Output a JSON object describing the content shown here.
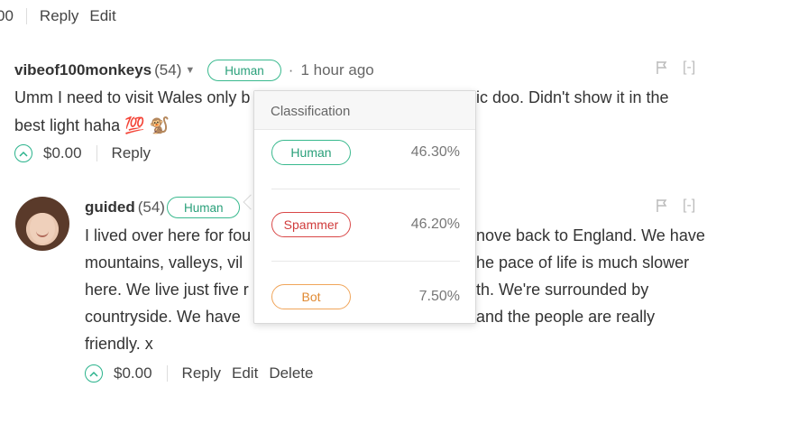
{
  "top_actions": {
    "money_fragment": "00",
    "reply": "Reply",
    "edit": "Edit"
  },
  "comment1": {
    "author": "vibeof100monkeys",
    "reputation": "(54)",
    "badge": "Human",
    "time": "1 hour ago",
    "body_line1_left": "Umm I need to visit Wales only b",
    "body_line1_right": "ic doo. Didn't show it in the",
    "body_line2": "best light haha",
    "emoji": "💯 🐒",
    "payout": "$0.00",
    "reply": "Reply",
    "hide": "[-]"
  },
  "comment2": {
    "author": "guided",
    "reputation": "(54)",
    "badge": "Human",
    "lines": [
      {
        "left": "I lived over here for fou",
        "right": "nove back to England. We have"
      },
      {
        "left": "mountains, valleys, vil",
        "right": "he pace of life is much slower"
      },
      {
        "left": "here. We live just five r",
        "right": "th. We're surrounded by"
      },
      {
        "left": "countryside. We have",
        "right": "and the people are really"
      }
    ],
    "last_line": "friendly. x",
    "payout": "$0.00",
    "reply": "Reply",
    "edit": "Edit",
    "delete": "Delete",
    "hide": "[-]"
  },
  "popover": {
    "title": "Classification",
    "rows": [
      {
        "label": "Human",
        "percent": "46.30%"
      },
      {
        "label": "Spammer",
        "percent": "46.20%"
      },
      {
        "label": "Bot",
        "percent": "7.50%"
      }
    ]
  },
  "colors": {
    "human": "#39b98e",
    "spammer": "#d94848",
    "bot": "#f0a55a"
  }
}
